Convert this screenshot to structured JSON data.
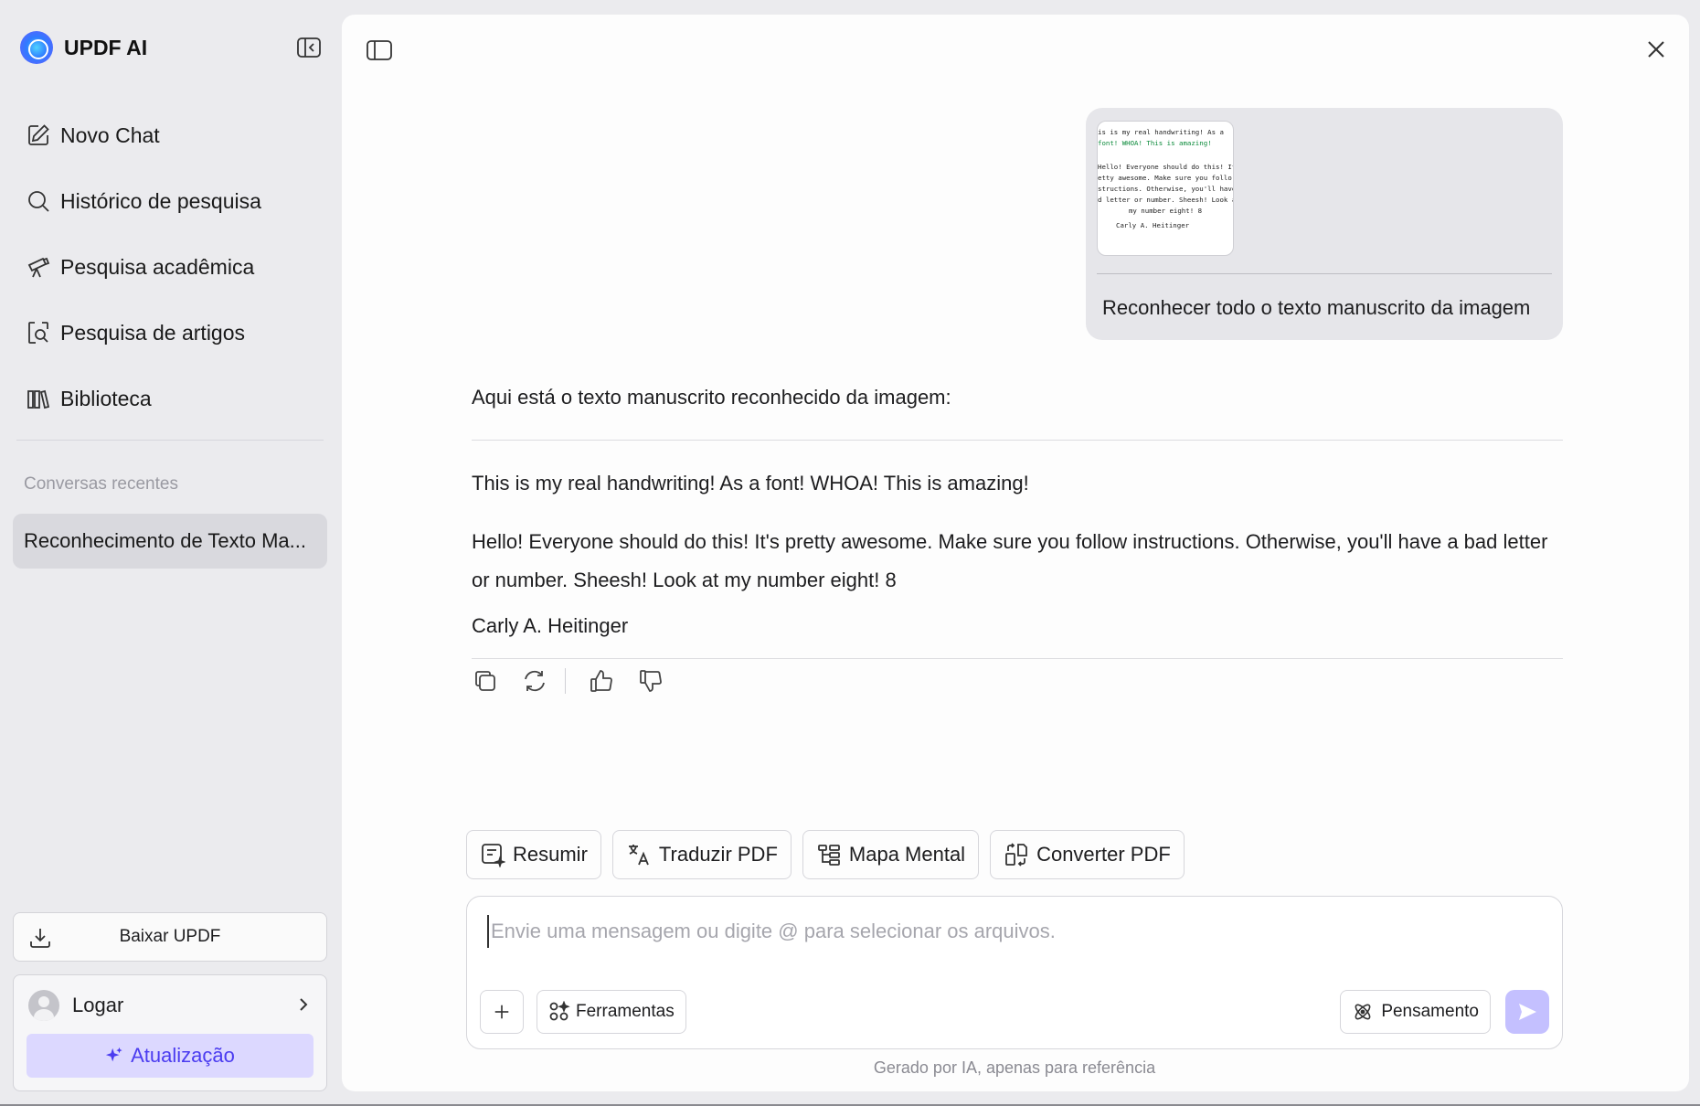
{
  "app": {
    "name": "UPDF AI"
  },
  "sidebar": {
    "items": [
      {
        "label": "Novo Chat",
        "icon": "edit-icon"
      },
      {
        "label": "Histórico de pesquisa",
        "icon": "search-icon"
      },
      {
        "label": "Pesquisa acadêmica",
        "icon": "telescope-icon"
      },
      {
        "label": "Pesquisa de artigos",
        "icon": "document-search-icon"
      },
      {
        "label": "Biblioteca",
        "icon": "library-icon"
      }
    ],
    "recent_label": "Conversas recentes",
    "recent_items": [
      {
        "label": "Reconhecimento de Texto Ma..."
      }
    ],
    "download_label": "Baixar UPDF",
    "login_label": "Logar",
    "upgrade_label": "Atualização"
  },
  "chat": {
    "user_message": {
      "text": "Reconhecer todo o texto manuscrito da imagem",
      "thumbnail_lines": [
        "is is my real handwriting! As a",
        "font! WHOA! This is amazing!",
        "",
        "Hello! Everyone should do this! It's",
        "etty awesome. Make sure you follo",
        "structions. Otherwise, you'll have a",
        "d letter or number. Sheesh! Look a",
        "my number eight! 8",
        "Carly A. Heitinger"
      ]
    },
    "answer": {
      "intro": "Aqui está o texto manuscrito reconhecido da imagem:",
      "line1": "This is my real handwriting! As a font! WHOA! This is amazing!",
      "paragraph": "Hello! Everyone should do this! It's pretty awesome. Make sure you follow instructions. Otherwise, you'll have a bad letter or number. Sheesh! Look at my number eight! 8",
      "signature": "Carly A. Heitinger"
    },
    "actions": [
      "copy-icon",
      "regenerate-icon",
      "thumbs-up-icon",
      "thumbs-down-icon"
    ]
  },
  "quick_actions": [
    {
      "label": "Resumir",
      "icon": "summarize-icon"
    },
    {
      "label": "Traduzir PDF",
      "icon": "translate-icon"
    },
    {
      "label": "Mapa Mental",
      "icon": "mind-map-icon"
    },
    {
      "label": "Converter PDF",
      "icon": "convert-icon"
    }
  ],
  "composer": {
    "placeholder": "Envie uma mensagem ou digite @ para selecionar os arquivos.",
    "value": "",
    "tools_label": "Ferramentas",
    "thinking_label": "Pensamento"
  },
  "footnote": "Gerado por IA, apenas para referência",
  "colors": {
    "accent": "#4b3cf0",
    "upgrade_bg": "#dcd8ff",
    "send_bg": "#c4c0ff"
  }
}
